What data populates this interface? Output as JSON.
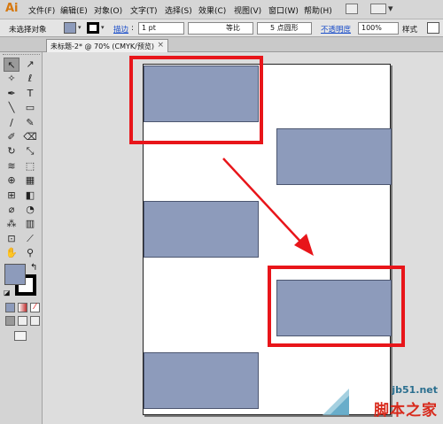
{
  "app": {
    "logo_text": "Ai"
  },
  "menu": {
    "items": [
      {
        "label": "文件(F)"
      },
      {
        "label": "编辑(E)"
      },
      {
        "label": "对象(O)"
      },
      {
        "label": "文字(T)"
      },
      {
        "label": "选择(S)"
      },
      {
        "label": "效果(C)"
      },
      {
        "label": "视图(V)"
      },
      {
        "label": "窗口(W)"
      },
      {
        "label": "帮助(H)"
      }
    ]
  },
  "control_bar": {
    "selection_status": "未选择对象",
    "stroke_label": "描边",
    "stroke_weight": "1 pt",
    "stroke_profile": "等比",
    "brush_label": "5 点圆形",
    "opacity_label": "不透明度",
    "opacity_value": "100%",
    "style_label": "样式"
  },
  "document_tab": {
    "title": "未标题-2* @ 70% (CMYK/预览)",
    "close_glyph": "×"
  },
  "colors": {
    "fill": "#8d9bbb",
    "stroke": "#000000",
    "highlight": "#e8151a",
    "rect_fill": "#8d9bbb"
  },
  "toolbox": {
    "tools": [
      {
        "name": "selection-tool",
        "glyph": "↖"
      },
      {
        "name": "direct-selection-tool",
        "glyph": "↗"
      },
      {
        "name": "magic-wand-tool",
        "glyph": "✧"
      },
      {
        "name": "lasso-tool",
        "glyph": "ℓ"
      },
      {
        "name": "pen-tool",
        "glyph": "✒"
      },
      {
        "name": "type-tool",
        "glyph": "T"
      },
      {
        "name": "line-tool",
        "glyph": "╲"
      },
      {
        "name": "rectangle-tool",
        "glyph": "▭"
      },
      {
        "name": "paintbrush-tool",
        "glyph": "∕"
      },
      {
        "name": "pencil-tool",
        "glyph": "✎"
      },
      {
        "name": "blob-brush-tool",
        "glyph": "✐"
      },
      {
        "name": "eraser-tool",
        "glyph": "⌫"
      },
      {
        "name": "rotate-tool",
        "glyph": "↻"
      },
      {
        "name": "scale-tool",
        "glyph": "⤡"
      },
      {
        "name": "warp-tool",
        "glyph": "≋"
      },
      {
        "name": "free-transform-tool",
        "glyph": "⬚"
      },
      {
        "name": "shape-builder-tool",
        "glyph": "⊕"
      },
      {
        "name": "perspective-grid-tool",
        "glyph": "▦"
      },
      {
        "name": "mesh-tool",
        "glyph": "⊞"
      },
      {
        "name": "gradient-tool",
        "glyph": "◧"
      },
      {
        "name": "eyedropper-tool",
        "glyph": "⌀"
      },
      {
        "name": "blend-tool",
        "glyph": "◔"
      },
      {
        "name": "symbol-sprayer-tool",
        "glyph": "⁂"
      },
      {
        "name": "column-graph-tool",
        "glyph": "▥"
      },
      {
        "name": "artboard-tool",
        "glyph": "⊡"
      },
      {
        "name": "slice-tool",
        "glyph": "⟋"
      },
      {
        "name": "hand-tool",
        "glyph": "✋"
      },
      {
        "name": "zoom-tool",
        "glyph": "⚲"
      }
    ]
  },
  "watermark": {
    "site": "jb51.net",
    "name": "脚本之家"
  }
}
